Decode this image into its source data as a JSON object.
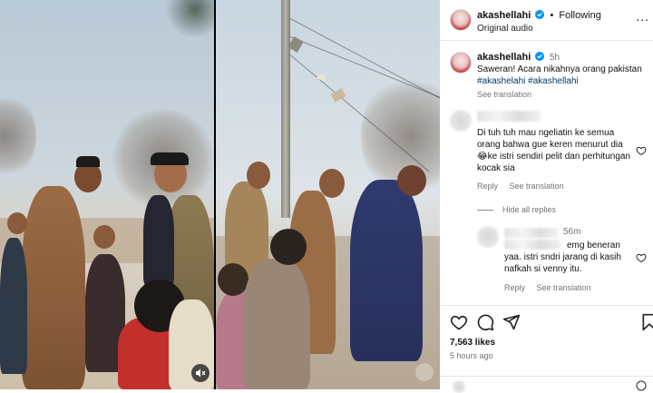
{
  "header": {
    "username": "akashellahi",
    "follow_status": "Following",
    "audio": "Original audio",
    "more": "..."
  },
  "caption": {
    "username": "akashellahi",
    "time": "5h",
    "text": "Saweran! Acara nikahnya orang pakistan",
    "hashtag_1": "#akashelahi",
    "hashtag_2": "#akashellahi",
    "see_translation": "See translation"
  },
  "comment_1": {
    "text": "Di tuh tuh mau ngeliatin ke semua orang bahwa gue keren menurut dia 😂ke istri sendiri pelit dan perhitungan kocak sia",
    "reply": "Reply",
    "see_translation": "See translation",
    "hide_replies": "Hide all replies"
  },
  "reply_1": {
    "time": "56m",
    "text_1": "emg beneran",
    "text_2": "yaa. istri sndri jarang di kasih nafkah si venny itu.",
    "reply": "Reply",
    "see_translation": "See translation"
  },
  "stats": {
    "likes": "7,563 likes",
    "posted": "5 hours ago"
  },
  "icons": {
    "like": "heart-icon",
    "comment": "comment-icon",
    "share": "share-icon",
    "save": "bookmark-icon",
    "mute": "speaker-muted-icon",
    "verified": "verified-badge-icon"
  },
  "colors": {
    "verified": "#0095f6",
    "link": "#00376b",
    "secondary_text": "#737373"
  }
}
